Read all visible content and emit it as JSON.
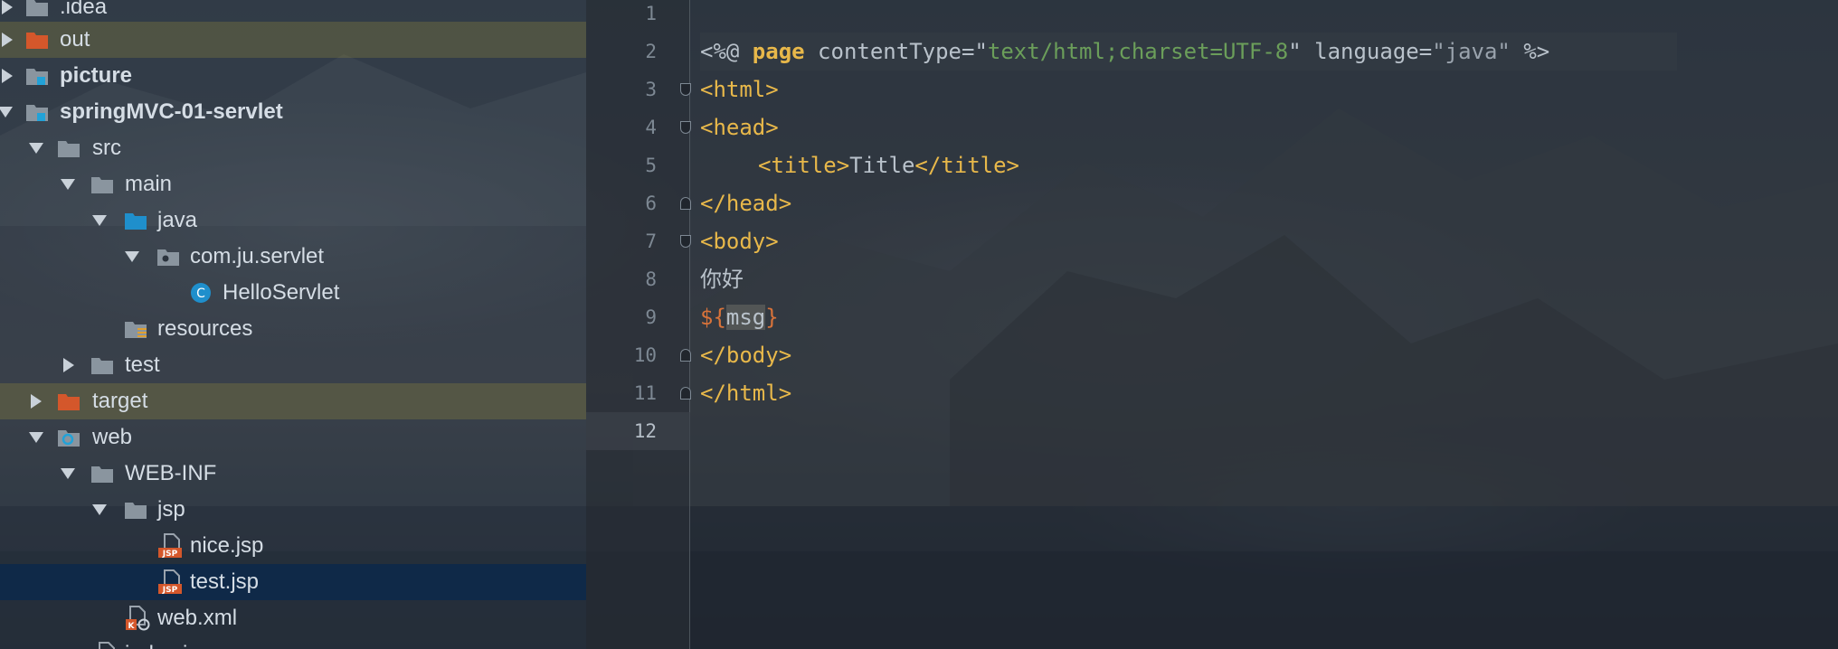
{
  "project_tree": {
    "items": [
      {
        "label": ".idea",
        "bold": false,
        "icon": "folder-icon"
      },
      {
        "label": "out",
        "bold": false,
        "icon": "excluded-folder-icon"
      },
      {
        "label": "picture",
        "bold": true,
        "icon": "module-folder-icon"
      },
      {
        "label": "springMVC-01-servlet",
        "bold": true,
        "icon": "module-folder-icon"
      },
      {
        "label": "src",
        "bold": false,
        "icon": "folder-icon"
      },
      {
        "label": "main",
        "bold": false,
        "icon": "folder-icon"
      },
      {
        "label": "java",
        "bold": false,
        "icon": "source-folder-icon"
      },
      {
        "label": "com.ju.servlet",
        "bold": false,
        "icon": "package-icon"
      },
      {
        "label": "HelloServlet",
        "bold": false,
        "icon": "java-class-icon"
      },
      {
        "label": "resources",
        "bold": false,
        "icon": "resources-folder-icon"
      },
      {
        "label": "test",
        "bold": false,
        "icon": "folder-icon"
      },
      {
        "label": "target",
        "bold": false,
        "icon": "excluded-folder-icon"
      },
      {
        "label": "web",
        "bold": false,
        "icon": "web-folder-icon"
      },
      {
        "label": "WEB-INF",
        "bold": false,
        "icon": "folder-icon"
      },
      {
        "label": "jsp",
        "bold": false,
        "icon": "folder-icon"
      },
      {
        "label": "nice.jsp",
        "bold": false,
        "icon": "jsp-file-icon"
      },
      {
        "label": "test.jsp",
        "bold": false,
        "icon": "jsp-file-icon"
      },
      {
        "label": "web.xml",
        "bold": false,
        "icon": "xml-config-file-icon"
      },
      {
        "label": "index.jsp",
        "bold": false,
        "icon": "jsp-file-icon"
      }
    ]
  },
  "editor": {
    "line_numbers": [
      "1",
      "2",
      "3",
      "4",
      "5",
      "6",
      "7",
      "8",
      "9",
      "10",
      "11",
      "12"
    ],
    "code": {
      "l2": {
        "open": "<%@ ",
        "kw": "page",
        "attr1": " contentType=",
        "q1": "\"",
        "val1": "text/html;charset=UTF-8",
        "q2": "\"",
        "attr2": " language=",
        "val2": "\"java\"",
        "close": " %>"
      },
      "l3": "<html>",
      "l4": "<head>",
      "l5": {
        "open": "<title>",
        "text": "Title",
        "close": "</title>"
      },
      "l6": "</head>",
      "l7": "<body>",
      "l8": "你好",
      "l9": {
        "prefix": "${",
        "var": "msg",
        "suffix": "}"
      },
      "l10": "</body>",
      "l11": "</html>"
    }
  },
  "colors": {
    "keyword": "#e8b84a",
    "string": "#6b9e5a",
    "el_expression": "#d8733a",
    "selection": "#0d294a"
  }
}
